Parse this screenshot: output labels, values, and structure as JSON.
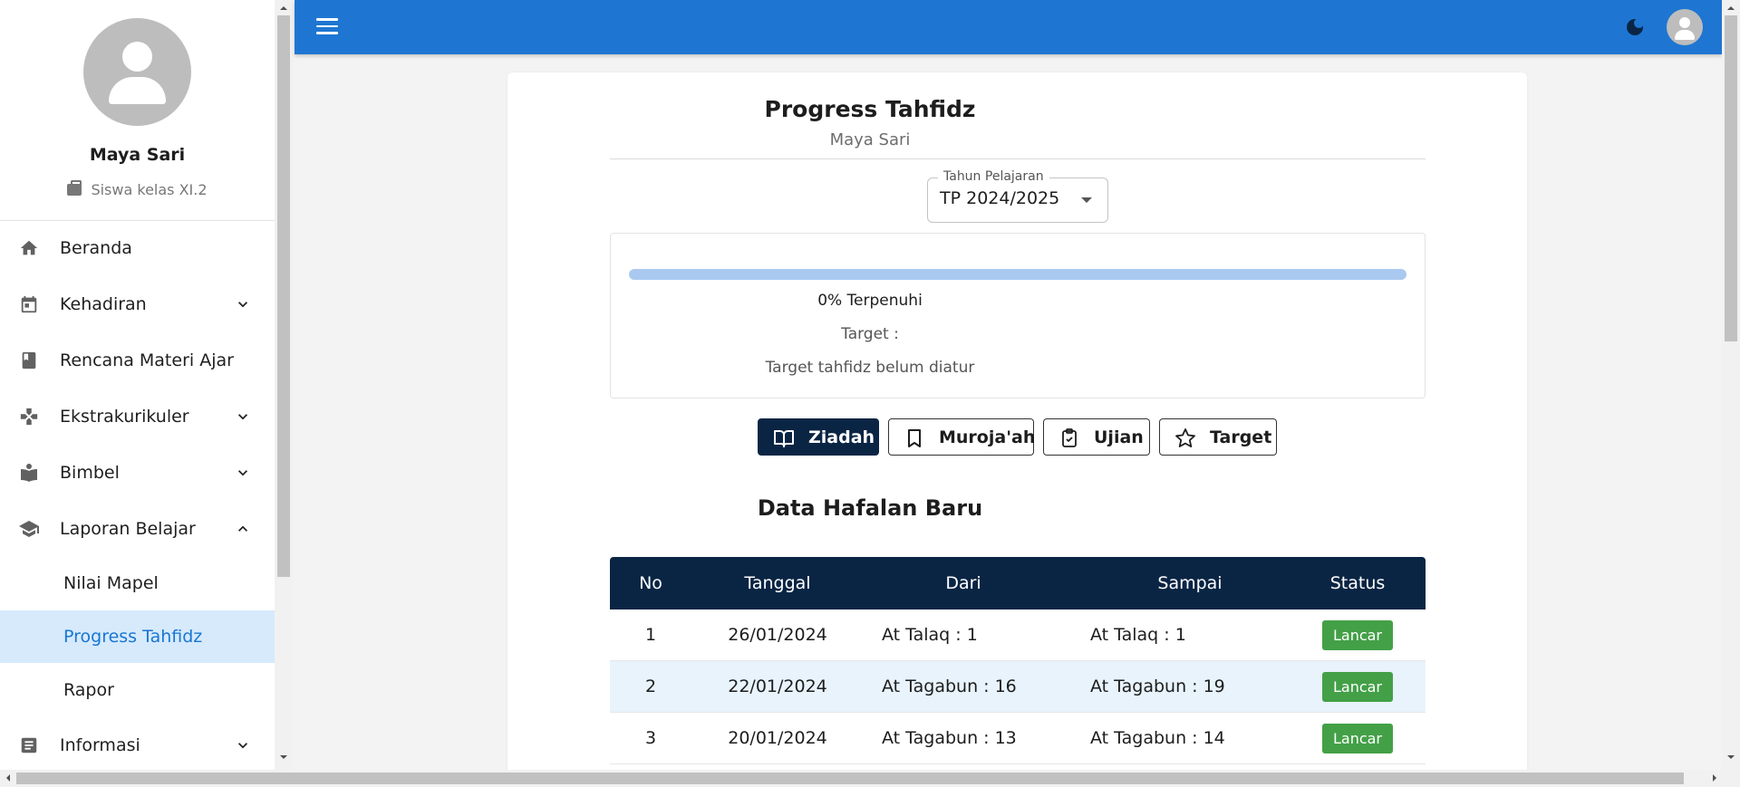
{
  "sidebar": {
    "profile": {
      "name": "Maya Sari",
      "role": "Siswa kelas XI.2"
    },
    "items": [
      {
        "label": "Beranda"
      },
      {
        "label": "Kehadiran"
      },
      {
        "label": "Rencana Materi Ajar"
      },
      {
        "label": "Ekstrakurikuler"
      },
      {
        "label": "Bimbel"
      },
      {
        "label": "Laporan Belajar"
      },
      {
        "label": "Informasi"
      }
    ],
    "sub_items": [
      {
        "label": "Nilai Mapel"
      },
      {
        "label": "Progress Tahfidz",
        "active": true
      },
      {
        "label": "Rapor"
      }
    ]
  },
  "topbar": {
    "color": "#1e76d2"
  },
  "main": {
    "title": "Progress Tahfidz",
    "subtitle": "Maya Sari",
    "year_select": {
      "label": "Tahun Pelajaran",
      "value": "TP 2024/2025"
    },
    "progress": {
      "value": 0,
      "text": "0% Terpenuhi",
      "target_label": "Target :",
      "target_note": "Target tahfidz belum diatur"
    },
    "tabs": [
      {
        "label": "Ziadah",
        "active": true
      },
      {
        "label": "Muroja'ah"
      },
      {
        "label": "Ujian"
      },
      {
        "label": "Target"
      }
    ],
    "section_title": "Data Hafalan Baru",
    "table": {
      "headers": [
        "No",
        "Tanggal",
        "Dari",
        "Sampai",
        "Status"
      ],
      "rows": [
        {
          "no": "1",
          "tanggal": "26/01/2024",
          "dari": "At Talaq : 1",
          "sampai": "At Talaq : 1",
          "status": "Lancar"
        },
        {
          "no": "2",
          "tanggal": "22/01/2024",
          "dari": "At Tagabun : 16",
          "sampai": "At Tagabun : 19",
          "status": "Lancar"
        },
        {
          "no": "3",
          "tanggal": "20/01/2024",
          "dari": "At Tagabun : 13",
          "sampai": "At Tagabun : 14",
          "status": "Lancar"
        }
      ]
    }
  }
}
